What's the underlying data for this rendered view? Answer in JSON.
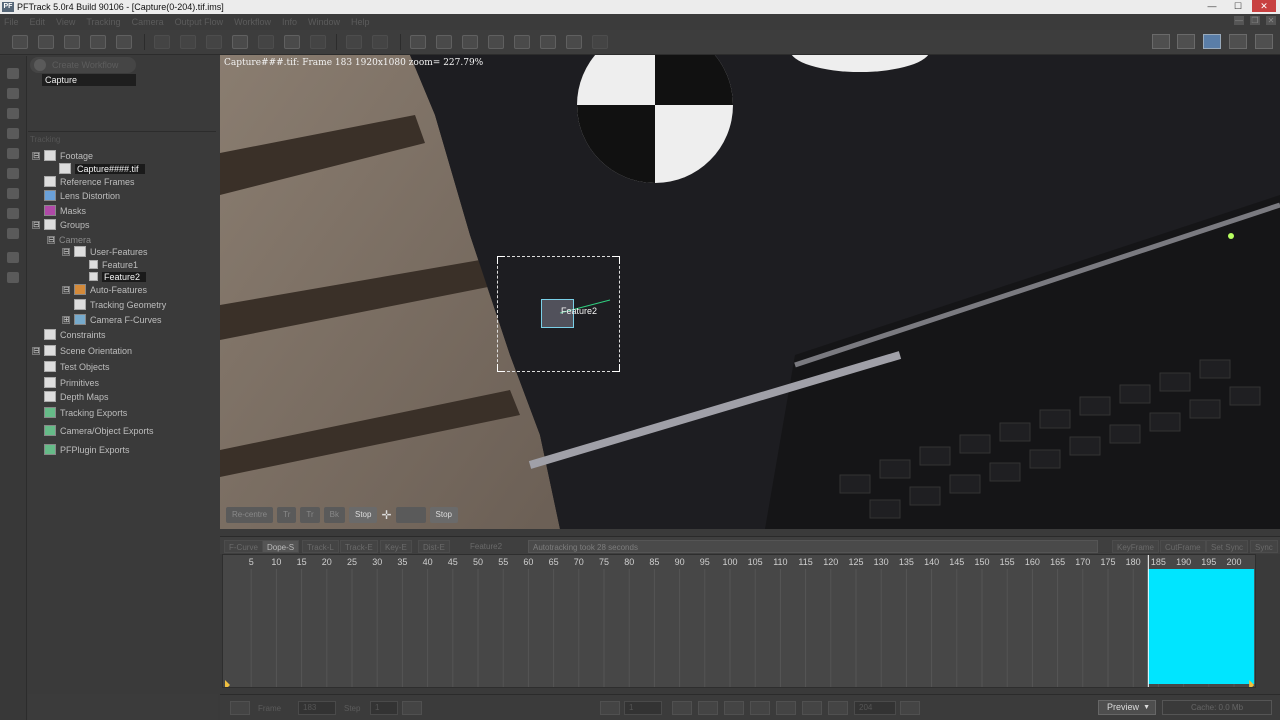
{
  "window": {
    "title": "PFTrack 5.0r4 Build 90106 - [Capture(0-204).tif.ims]",
    "app_icon": "PF",
    "controls": [
      "—",
      "☐",
      "✕"
    ]
  },
  "menu": {
    "items": [
      "File",
      "Edit",
      "View",
      "Tracking",
      "Camera",
      "Output Flow",
      "Workflow",
      "Info",
      "Window",
      "Help"
    ],
    "mdi_controls": [
      "—",
      "❐",
      "✕"
    ]
  },
  "node_panel": {
    "tab_label": "Create Workflow",
    "node": "Capture"
  },
  "tree": {
    "header": "Tracking",
    "items": [
      {
        "label": "Footage",
        "indent": 0,
        "exp": "⊟",
        "icon": "light"
      },
      {
        "label": "Capture####.tif",
        "indent": 1,
        "exp": "",
        "icon": "light",
        "selected": true
      },
      {
        "label": "Reference Frames",
        "indent": 0,
        "exp": "",
        "icon": "light"
      },
      {
        "label": "Lens Distortion",
        "indent": 0,
        "exp": "",
        "icon": "blue"
      },
      {
        "label": "Masks",
        "indent": 0,
        "exp": "",
        "icon": "purple"
      },
      {
        "label": "Groups",
        "indent": 0,
        "exp": "⊟",
        "icon": "light"
      },
      {
        "label": "Camera",
        "indent": 1,
        "exp": "⊟",
        "icon": "none",
        "dim": true
      },
      {
        "label": "User-Features",
        "indent": 2,
        "exp": "⊟",
        "icon": "light"
      },
      {
        "label": "Feature1",
        "indent": 3,
        "exp": "",
        "icon": "light",
        "small": true
      },
      {
        "label": "Feature2",
        "indent": 3,
        "exp": "",
        "icon": "light",
        "small": true,
        "selected": true
      },
      {
        "label": "Auto-Features",
        "indent": 2,
        "exp": "⊟",
        "icon": "orange"
      },
      {
        "label": "Tracking Geometry",
        "indent": 2,
        "exp": "",
        "icon": "light"
      },
      {
        "label": "Camera F-Curves",
        "indent": 2,
        "exp": "⊞",
        "icon": "cyan"
      },
      {
        "label": "Constraints",
        "indent": 0,
        "exp": "",
        "icon": "light"
      },
      {
        "label": "Scene Orientation",
        "indent": 0,
        "exp": "⊟",
        "icon": "light"
      },
      {
        "label": "Test Objects",
        "indent": 0,
        "exp": "",
        "icon": "light"
      },
      {
        "label": "Primitives",
        "indent": 0,
        "exp": "",
        "icon": "light"
      },
      {
        "label": "Depth Maps",
        "indent": 0,
        "exp": "",
        "icon": "light"
      },
      {
        "label": "Tracking Exports",
        "indent": 0,
        "exp": "",
        "icon": "green"
      },
      {
        "label": "Camera/Object Exports",
        "indent": 0,
        "exp": "",
        "icon": "green"
      },
      {
        "label": "PFPlugin Exports",
        "indent": 0,
        "exp": "",
        "icon": "green"
      }
    ]
  },
  "viewer": {
    "info": "Capture###.tif: Frame 183  1920x1080 zoom= 227.79%",
    "feature_label": "Feature2"
  },
  "track_controls": [
    "Re-centre",
    "Tr",
    "Tr",
    "Bk",
    "Stop",
    "",
    "Stop"
  ],
  "timeline_tabs": [
    "F-Curve",
    "Dope-S",
    "Track-L",
    "Track-E",
    "Key-E",
    "Dist-E",
    "Feature2"
  ],
  "timeline_status": "Autotracking took 28 seconds",
  "timeline_right_tabs": [
    "KeyFrame",
    "CutFrame",
    "Set Sync",
    "Sync"
  ],
  "frame_ticks": [
    "5",
    "10",
    "15",
    "20",
    "25",
    "30",
    "35",
    "40",
    "45",
    "50",
    "55",
    "60",
    "65",
    "70",
    "75",
    "80",
    "85",
    "90",
    "95",
    "100",
    "105",
    "110",
    "115",
    "120",
    "125",
    "130",
    "135",
    "140",
    "145",
    "150",
    "155",
    "160",
    "165",
    "170",
    "175",
    "180",
    "185",
    "190",
    "195",
    "200"
  ],
  "current_frame": 183,
  "highlight_range": [
    183,
    204
  ],
  "playback": {
    "frame_label": "Frame",
    "frame_value": "183",
    "step_label": "Step",
    "step_value": "1",
    "start_value": "1",
    "end_value": "204",
    "preview": "Preview",
    "cache": "Cache: 0.0 Mb"
  },
  "colors": {
    "highlight": "#00e5ff",
    "marker": "#f0c040"
  }
}
